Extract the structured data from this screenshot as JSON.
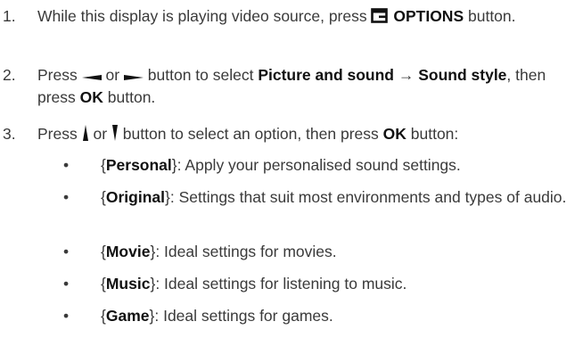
{
  "steps": [
    {
      "number": "1.",
      "pre": "While this display is playing video source, press ",
      "button": "OPTIONS",
      "post": " button."
    },
    {
      "number": "2.",
      "pre": "Press ",
      "or": " or ",
      "mid": " button to select ",
      "path1": "Picture and sound",
      "arrow": "→",
      "path2": "Sound style",
      "then": ", then press ",
      "ok": "OK",
      "post": " button."
    },
    {
      "number": "3.",
      "pre": "Press ",
      "or": " or ",
      "mid": " button to select an option, then press ",
      "ok": "OK",
      "post": " button:"
    }
  ],
  "options": [
    {
      "name": "Personal",
      "desc": ": Apply your personalised sound settings."
    },
    {
      "name": "Original",
      "desc": ": Settings that suit most environments and types of audio."
    },
    {
      "name": "Movie",
      "desc": ": Ideal settings for movies."
    },
    {
      "name": "Music",
      "desc": ": Ideal settings for listening to music."
    },
    {
      "name": "Game",
      "desc": ": Ideal settings for games."
    }
  ],
  "icons": {
    "options": "options-icon",
    "left": "left-arrow-icon",
    "right": "right-arrow-icon",
    "up": "up-arrow-icon",
    "down": "down-arrow-icon"
  }
}
